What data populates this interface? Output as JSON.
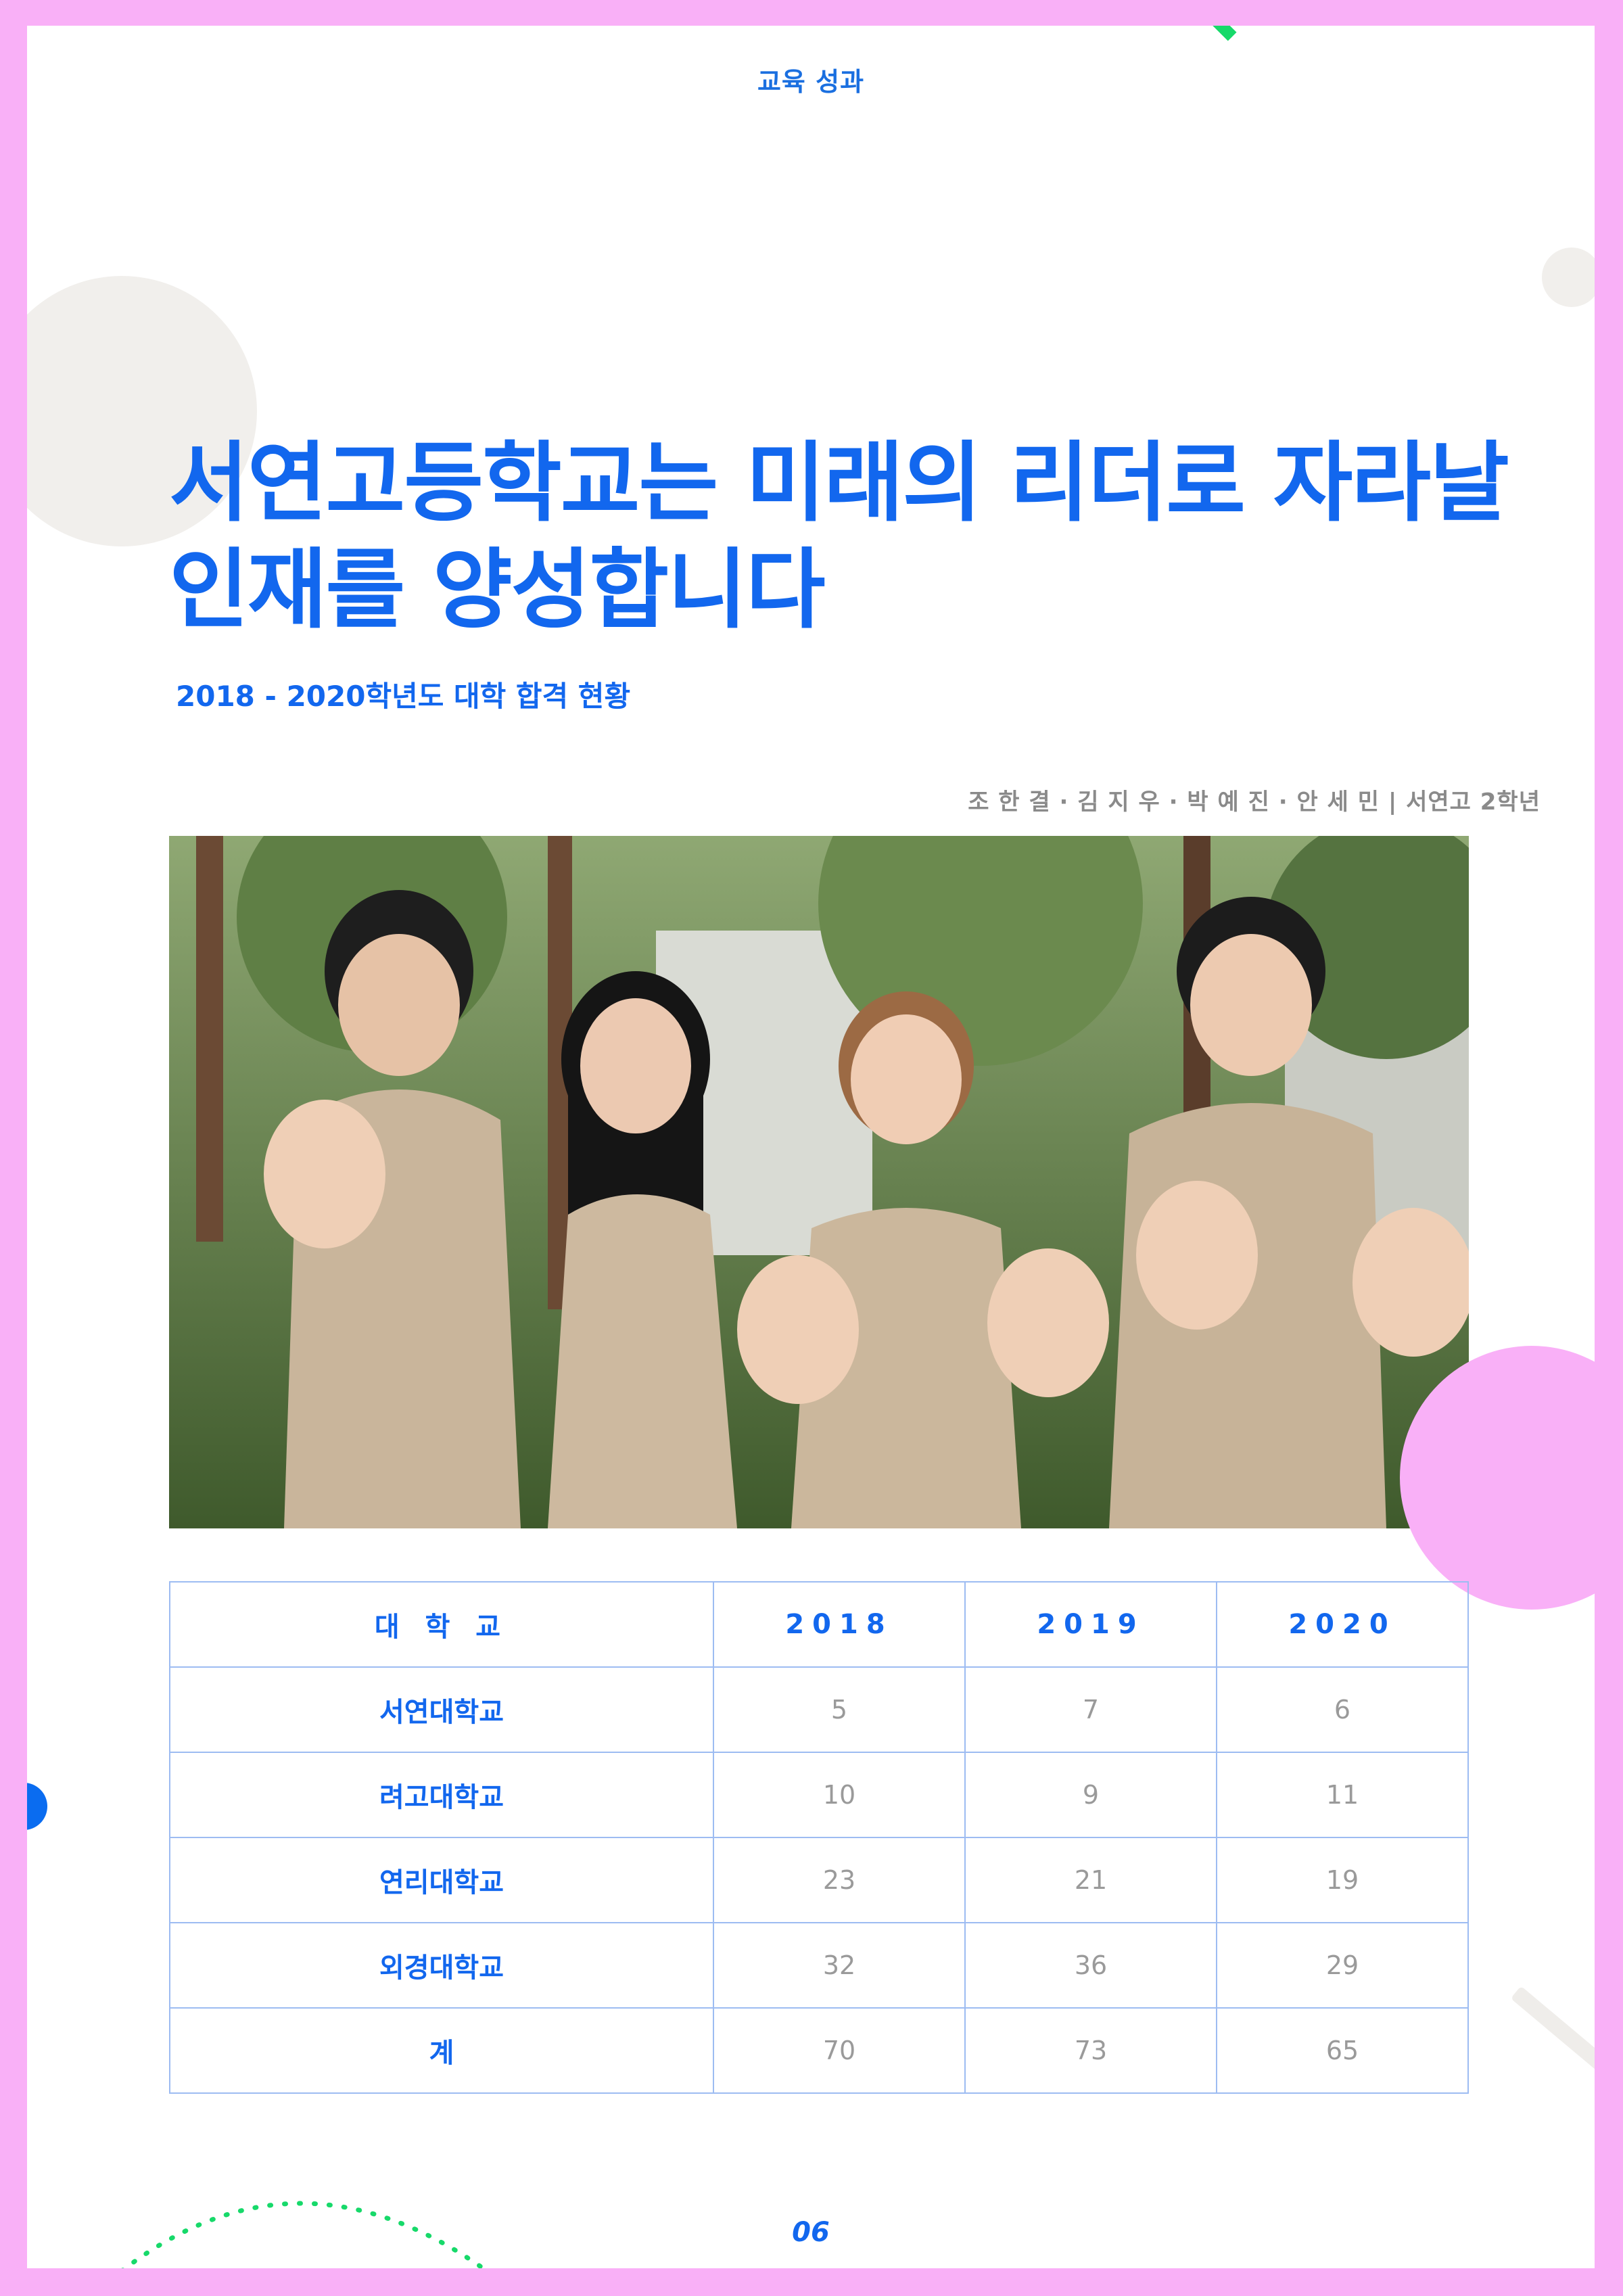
{
  "header": {
    "section": "교육 성과"
  },
  "title": {
    "line1": "서연고등학교는 미래의 리더로 자라날",
    "line2": "인재를 양성합니다"
  },
  "subtitle": "2018 - 2020학년도 대학 합격 현황",
  "credit": "조 한 결 · 김 지 우 · 박 예 진 · 안 세 민 | 서연고 2학년",
  "table": {
    "headers": [
      "대 학 교",
      "2018",
      "2019",
      "2020"
    ],
    "rows": [
      [
        "서연대학교",
        "5",
        "7",
        "6"
      ],
      [
        "려고대학교",
        "10",
        "9",
        "11"
      ],
      [
        "연리대학교",
        "23",
        "21",
        "19"
      ],
      [
        "외경대학교",
        "32",
        "36",
        "29"
      ],
      [
        "계",
        "70",
        "73",
        "65"
      ]
    ]
  },
  "page_number": "06",
  "colors": {
    "accent": "#1267ee",
    "frame": "#f9b0f7",
    "green": "#17d96a",
    "table_border": "#9dbcf2"
  }
}
